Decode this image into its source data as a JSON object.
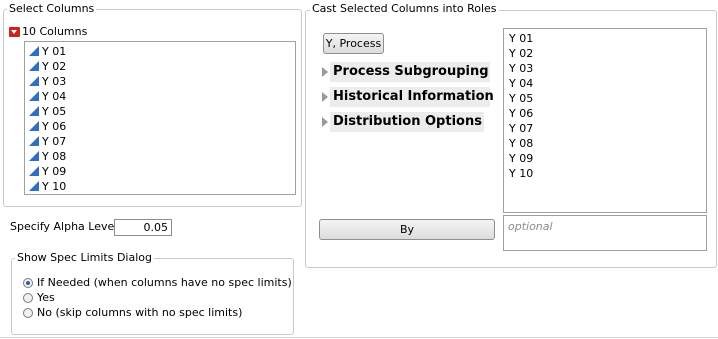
{
  "select_columns": {
    "title": "Select Columns",
    "count_label": "10 Columns",
    "columns": [
      "Y 01",
      "Y 02",
      "Y 03",
      "Y 04",
      "Y 05",
      "Y 06",
      "Y 07",
      "Y 08",
      "Y 09",
      "Y 10"
    ]
  },
  "cast_roles": {
    "title": "Cast Selected Columns into Roles",
    "y_process_button": "Y, Process",
    "y_process_items": [
      "Y 01",
      "Y 02",
      "Y 03",
      "Y 04",
      "Y 05",
      "Y 06",
      "Y 07",
      "Y 08",
      "Y 09",
      "Y 10"
    ],
    "sections": [
      "Process Subgrouping",
      "Historical Information",
      "Distribution Options"
    ],
    "by_button": "By",
    "by_placeholder": "optional"
  },
  "alpha": {
    "label": "Specify Alpha Level",
    "value": "0.05"
  },
  "spec_limits": {
    "title": "Show Spec Limits Dialog",
    "options": [
      {
        "label": "If Needed (when columns have no spec limits)",
        "selected": true
      },
      {
        "label": "Yes",
        "selected": false
      },
      {
        "label": "No (skip columns with no spec limits)",
        "selected": false
      }
    ]
  },
  "colors": {
    "continuous_icon": "#2e6fc4",
    "menu_arrow": "#cc2222",
    "group_border": "#c9c9c9"
  }
}
